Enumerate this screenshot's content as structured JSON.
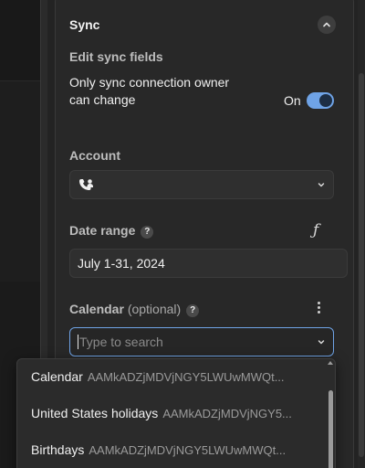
{
  "section": {
    "title": "Sync"
  },
  "edit_sync": {
    "label": "Edit sync fields",
    "description": "Only sync connection owner can change",
    "toggle_label": "On",
    "toggle_on": true
  },
  "account": {
    "label": "Account",
    "icon": "account-contact-icon"
  },
  "date_range": {
    "label": "Date range",
    "value": "July 1-31, 2024",
    "formula_icon": "ƒ"
  },
  "calendar": {
    "label": "Calendar",
    "optional": "(optional)",
    "placeholder": "Type to search"
  },
  "dropdown": {
    "items": [
      {
        "name": "Calendar",
        "id": "AAMkADZjMDVjNGY5LWUwMWQt..."
      },
      {
        "name": "United States holidays",
        "id": "AAMkADZjMDVjNGY5..."
      },
      {
        "name": "Birthdays",
        "id": "AAMkADZjMDVjNGY5LWUwMWQt..."
      }
    ]
  },
  "colors": {
    "accent": "#6fa3e6",
    "panel": "#282828",
    "background": "#1f1f1f"
  }
}
